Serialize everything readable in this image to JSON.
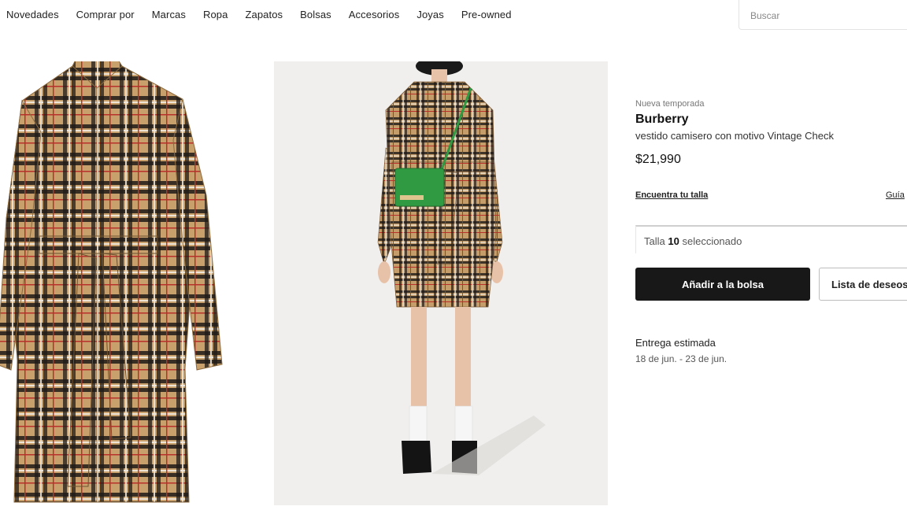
{
  "nav": {
    "items": [
      {
        "label": "Novedades"
      },
      {
        "label": "Comprar por"
      },
      {
        "label": "Marcas"
      },
      {
        "label": "Ropa"
      },
      {
        "label": "Zapatos"
      },
      {
        "label": "Bolsas"
      },
      {
        "label": "Accesorios"
      },
      {
        "label": "Joyas"
      },
      {
        "label": "Pre-owned"
      }
    ]
  },
  "search": {
    "placeholder": "Buscar"
  },
  "product": {
    "season": "Nueva temporada",
    "brand": "Burberry",
    "description": "vestido camisero con motivo Vintage Check",
    "price": "$21,990",
    "find_size_label": "Encuentra tu talla",
    "size_guide_label": "Guía",
    "size_prefix": "Talla",
    "size_value": "10",
    "size_suffix": "seleccionado",
    "add_to_bag_label": "Añadir a la bolsa",
    "wishlist_label": "Lista de deseos",
    "delivery_title": "Entrega estimada",
    "delivery_dates": "18 de jun. - 23 de jun."
  },
  "colors": {
    "plaid_base": "#c8a06c",
    "plaid_dark": "#1e1a18",
    "plaid_red": "#b8312a",
    "plaid_white": "#f1ebe0",
    "bag_green": "#2f9a42",
    "button_dark": "#181818"
  }
}
